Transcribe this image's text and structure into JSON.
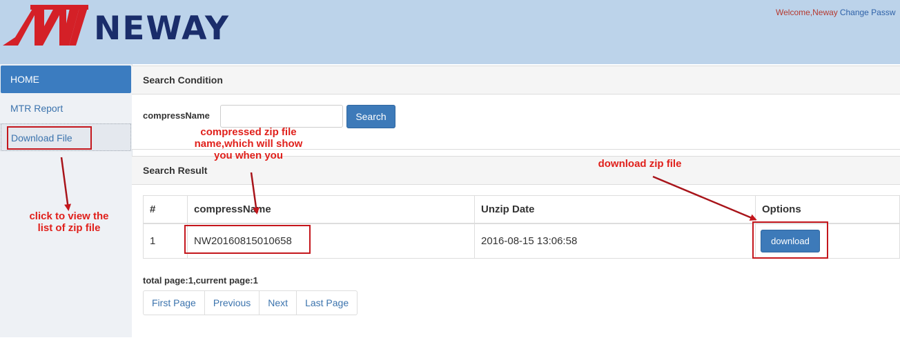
{
  "header": {
    "brand": "NEWAY",
    "welcome": "Welcome,Neway",
    "change_password": "Change Passw"
  },
  "sidebar": {
    "items": [
      {
        "label": "HOME"
      },
      {
        "label": "MTR Report"
      },
      {
        "label": "Download File"
      }
    ]
  },
  "search": {
    "title": "Search Condition",
    "field_label": "compressName",
    "value": "",
    "button": "Search"
  },
  "results": {
    "title": "Search Result",
    "columns": [
      "#",
      "compressName",
      "Unzip Date",
      "Options"
    ],
    "rows": [
      {
        "index": "1",
        "name": "NW20160815010658",
        "date": "2016-08-15 13:06:58",
        "action": "download"
      }
    ],
    "page_info": "total page:1,current page:1",
    "pager": [
      "First Page",
      "Previous",
      "Next",
      "Last Page"
    ]
  },
  "annotations": {
    "click_note": "click  to view the\nlist of zip file",
    "name_note": "compressed zip file\nname,which will show\nyou when you",
    "download_note": "download zip file"
  },
  "colors": {
    "header_bg": "#bcd3ea",
    "logo_red": "#d42027",
    "logo_navy": "#1a2d6b",
    "primary": "#3d7ab9",
    "annotation_red": "#e0201b"
  }
}
